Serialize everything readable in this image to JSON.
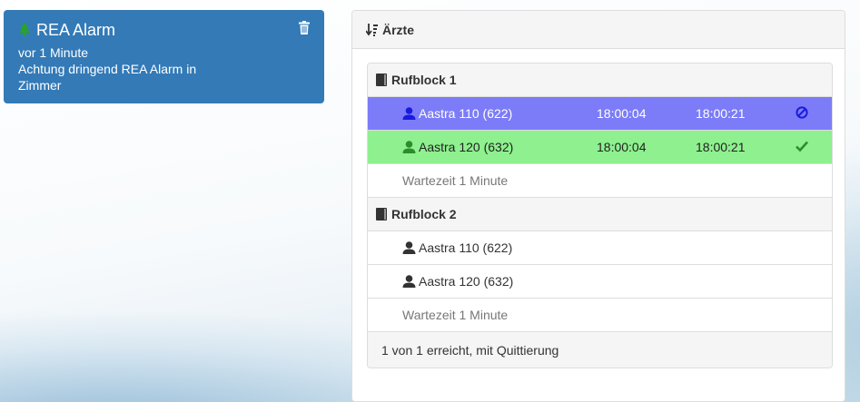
{
  "alarm": {
    "title": "REA Alarm",
    "time": "vor 1 Minute",
    "message": "Achtung dringend REA Alarm in Zimmer",
    "tree_icon_color": "#2ca02c"
  },
  "panel": {
    "title": "Ärzte",
    "blocks": [
      {
        "label": "Rufblock 1",
        "devices": [
          {
            "name": "Aastra 110 (622)",
            "start": "18:00:04",
            "end": "18:00:21",
            "status": "ban-icon",
            "row_color": "#7c7cf8"
          },
          {
            "name": "Aastra 120 (632)",
            "start": "18:00:04",
            "end": "18:00:21",
            "status": "check-icon",
            "row_color": "#8ef08e"
          }
        ],
        "wait": "Wartezeit 1 Minute"
      },
      {
        "label": "Rufblock 2",
        "devices": [
          {
            "name": "Aastra 110 (622)"
          },
          {
            "name": "Aastra 120 (632)"
          }
        ],
        "wait": "Wartezeit 1 Minute"
      }
    ],
    "footer": "1 von 1 erreicht, mit Quittierung"
  }
}
